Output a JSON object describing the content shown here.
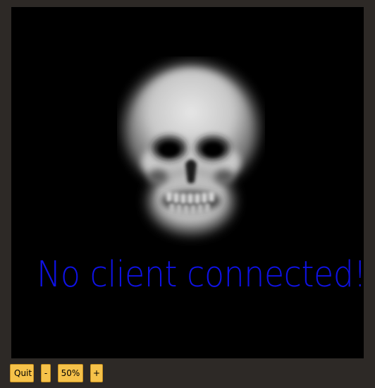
{
  "viewer": {
    "background": "#000000",
    "image": "skull-icon",
    "status_message": "No client connected!",
    "status_color": "#0f12e6"
  },
  "controls": {
    "quit_label": "Quit",
    "zoom_out_label": "-",
    "zoom_level": "50%",
    "zoom_in_label": "+",
    "button_color": "#f6c24a"
  },
  "window": {
    "background": "#2d2926"
  }
}
